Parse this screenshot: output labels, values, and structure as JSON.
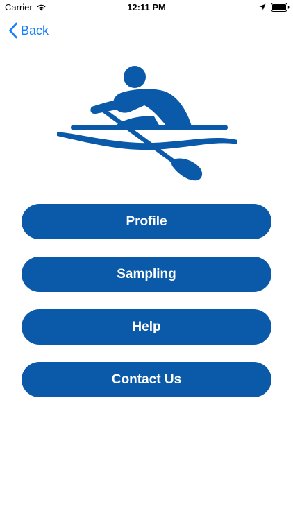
{
  "status_bar": {
    "carrier": "Carrier",
    "time": "12:11 PM",
    "icons": [
      "wifi-icon",
      "location-arrow-icon",
      "battery-icon"
    ]
  },
  "nav": {
    "back_label": "Back",
    "icon": "chevron-left-icon"
  },
  "logo": {
    "icon": "rowing-person-icon",
    "color": "#0a5aa9"
  },
  "menu": {
    "items": [
      {
        "label": "Profile"
      },
      {
        "label": "Sampling"
      },
      {
        "label": "Help"
      },
      {
        "label": "Contact Us"
      }
    ]
  },
  "colors": {
    "accent": "#0a5aa9",
    "link": "#157efb",
    "background": "#ffffff"
  }
}
